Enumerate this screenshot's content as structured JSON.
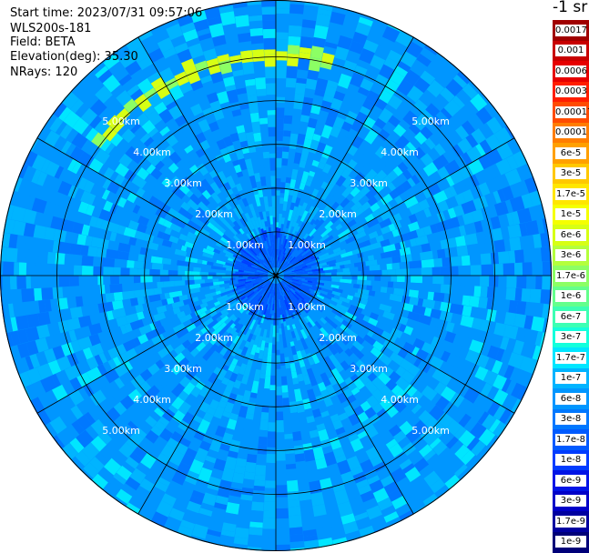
{
  "header": {
    "start_time": "Start time: 2023/07/31 09:57:06",
    "instrument": "WLS200s-181",
    "field": "Field: BETA",
    "elevation": "Elevation(deg): 35.30",
    "nrays": "NRays: 120"
  },
  "unit_title": "-1 sr",
  "chart_data": {
    "type": "heatmap",
    "projection": "polar (PPI)",
    "field": "BETA",
    "elevation_deg": 35.3,
    "n_rays": 120,
    "range_rings_km": [
      1.0,
      2.0,
      3.0,
      4.0,
      5.0
    ],
    "range_ring_labels": [
      "1.00km",
      "2.00km",
      "3.00km",
      "4.00km",
      "5.00km"
    ],
    "azimuth_lines_deg": [
      0,
      30,
      60,
      90,
      120,
      150,
      180,
      210,
      240,
      270,
      300,
      330
    ],
    "max_range_km": 6.3,
    "colorbar": {
      "labels": [
        "0.0017",
        "0.001",
        "0.0006",
        "0.0003",
        "0.00017",
        "0.0001",
        "6e-5",
        "3e-5",
        "1.7e-5",
        "1e-5",
        "6e-6",
        "3e-6",
        "1.7e-6",
        "1e-6",
        "6e-7",
        "3e-7",
        "1.7e-7",
        "1e-7",
        "6e-8",
        "3e-8",
        "1.7e-8",
        "1e-8",
        "6e-9",
        "3e-9",
        "1.7e-9",
        "1e-9"
      ],
      "colors": [
        "#a00000",
        "#c80000",
        "#e60000",
        "#ff1e00",
        "#ff4b00",
        "#ff7d00",
        "#ffa000",
        "#ffc800",
        "#ffe600",
        "#f5ff00",
        "#d7ff14",
        "#b4ff3c",
        "#8cff64",
        "#64ff8c",
        "#3cffb4",
        "#14ffdc",
        "#00e6ff",
        "#00b4ff",
        "#0096ff",
        "#0078ff",
        "#005aff",
        "#003cff",
        "#0014e6",
        "#0000c8",
        "#0000a0",
        "#000078"
      ]
    },
    "dominant_level": "1e-7 to 3e-8",
    "features": [
      {
        "kind": "arc",
        "azimuth_deg": [
          305,
          12
        ],
        "range_km": [
          4.9,
          5.2
        ],
        "level": "1e-6 to 1.7e-6"
      }
    ]
  }
}
